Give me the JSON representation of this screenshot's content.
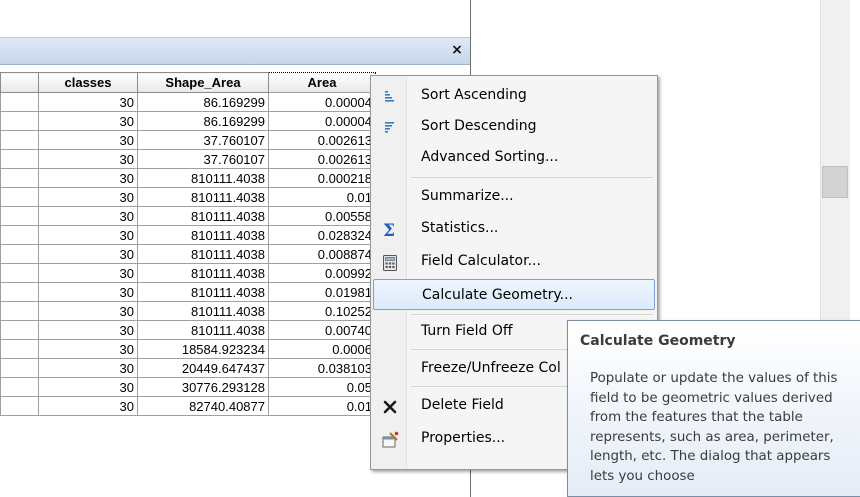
{
  "table": {
    "close_label": "×",
    "columns": [
      "",
      "classes",
      "Shape_Area",
      "Area"
    ],
    "rows": [
      [
        "",
        "30",
        "86.169299",
        "0.00004"
      ],
      [
        "",
        "30",
        "86.169299",
        "0.00004"
      ],
      [
        "",
        "30",
        "37.760107",
        "0.002613"
      ],
      [
        "",
        "30",
        "37.760107",
        "0.002613"
      ],
      [
        "",
        "30",
        "810111.4038",
        "0.000218"
      ],
      [
        "",
        "30",
        "810111.4038",
        "0.01"
      ],
      [
        "",
        "30",
        "810111.4038",
        "0.00558"
      ],
      [
        "",
        "30",
        "810111.4038",
        "0.028324"
      ],
      [
        "",
        "30",
        "810111.4038",
        "0.008874"
      ],
      [
        "",
        "30",
        "810111.4038",
        "0.00992"
      ],
      [
        "",
        "30",
        "810111.4038",
        "0.01981"
      ],
      [
        "",
        "30",
        "810111.4038",
        "0.10252"
      ],
      [
        "",
        "30",
        "810111.4038",
        "0.00740"
      ],
      [
        "",
        "30",
        "18584.923234",
        "0.0006"
      ],
      [
        "",
        "30",
        "20449.647437",
        "0.038103"
      ],
      [
        "",
        "30",
        "30776.293128",
        "0.05"
      ],
      [
        "",
        "30",
        "82740.40877",
        "0.01"
      ]
    ]
  },
  "context_menu": {
    "items": [
      {
        "label": "Sort Ascending",
        "icon": "sort-ascending-icon"
      },
      {
        "label": "Sort Descending",
        "icon": "sort-descending-icon"
      },
      {
        "label": "Advanced Sorting...",
        "icon": ""
      },
      {
        "label": "Summarize...",
        "icon": ""
      },
      {
        "label": "Statistics...",
        "icon": "sigma-icon"
      },
      {
        "label": "Field Calculator...",
        "icon": "calculator-icon"
      },
      {
        "label": "Calculate Geometry...",
        "icon": "",
        "highlighted": true
      },
      {
        "label": "Turn Field Off",
        "icon": ""
      },
      {
        "label": "Freeze/Unfreeze Col",
        "icon": ""
      },
      {
        "label": "Delete Field",
        "icon": "delete-icon"
      },
      {
        "label": "Properties...",
        "icon": "properties-icon"
      }
    ]
  },
  "tooltip": {
    "title": "Calculate Geometry",
    "body": "Populate or update the values of this field to be geometric values derived from the features that the table represents, such as area, perimeter, length, etc. The dialog that appears lets you choose"
  },
  "colors": {
    "title_bar": "#c6d6ea",
    "highlight_border": "#7da2ce",
    "sigma_blue": "#1f5fbf"
  }
}
